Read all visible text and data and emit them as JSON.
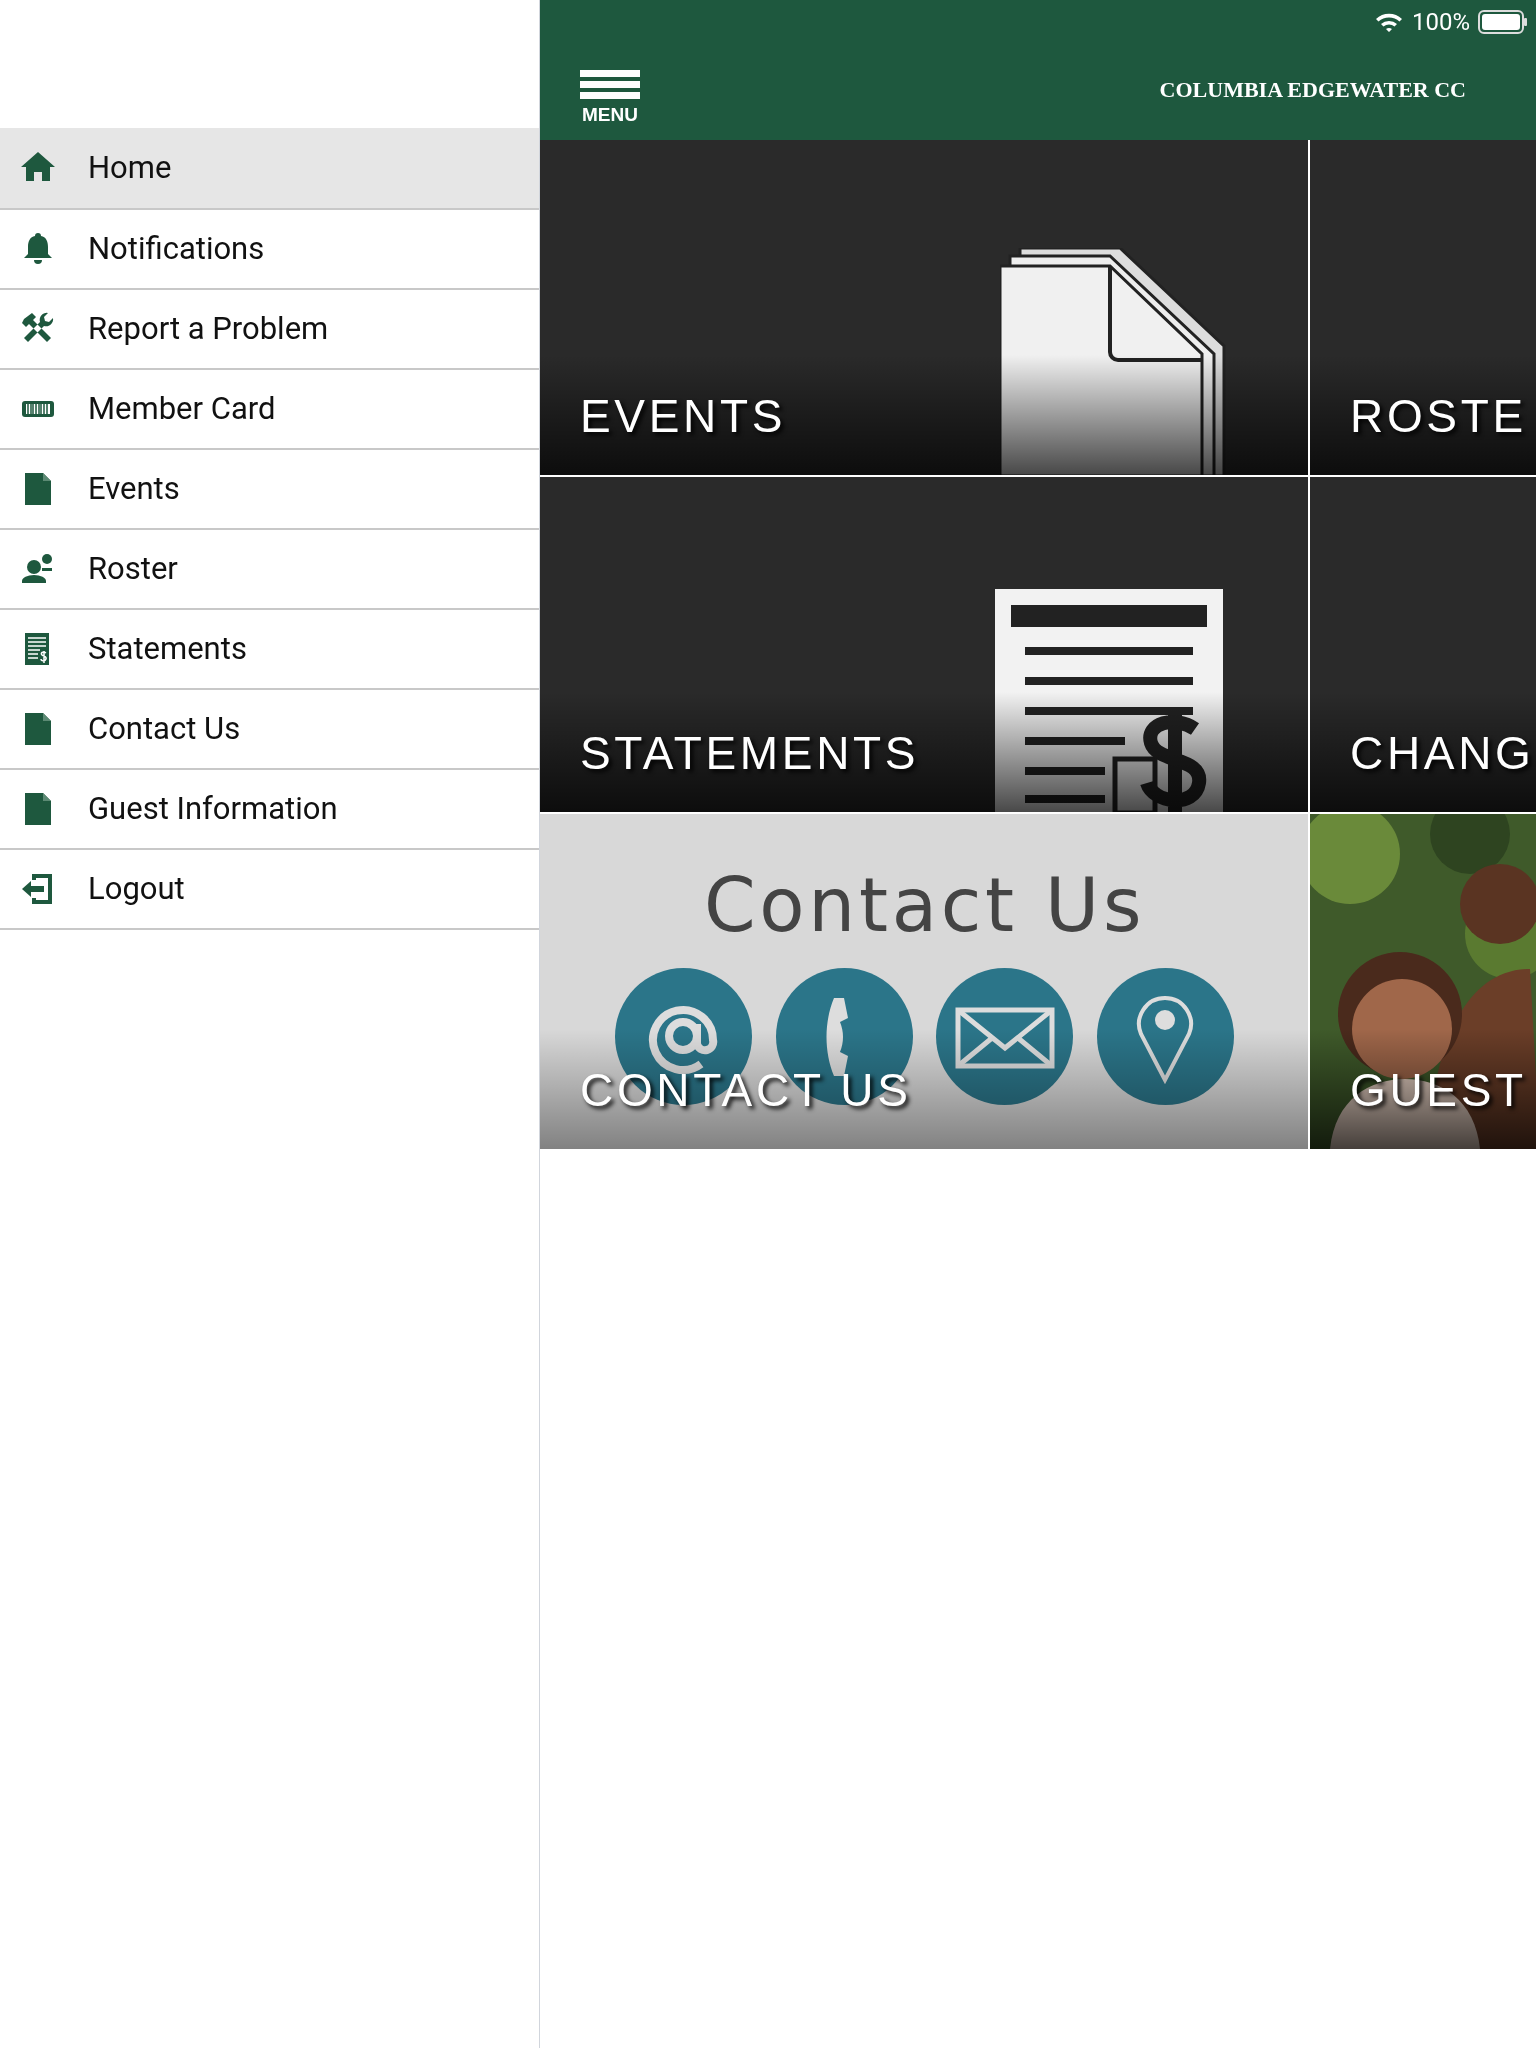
{
  "status_bar": {
    "battery": "100%"
  },
  "header": {
    "menu_label": "MENU",
    "title": "COLUMBIA EDGEWATER CC"
  },
  "sidebar": {
    "items": [
      {
        "label": "Home",
        "selected": true
      },
      {
        "label": "Notifications",
        "selected": false
      },
      {
        "label": "Report a Problem",
        "selected": false
      },
      {
        "label": "Member Card",
        "selected": false
      },
      {
        "label": "Events",
        "selected": false
      },
      {
        "label": "Roster",
        "selected": false
      },
      {
        "label": "Statements",
        "selected": false
      },
      {
        "label": "Contact Us",
        "selected": false
      },
      {
        "label": "Guest Information",
        "selected": false
      },
      {
        "label": "Logout",
        "selected": false
      }
    ]
  },
  "tiles": [
    {
      "label": "EVENTS",
      "kind": "events"
    },
    {
      "label": "ROSTE",
      "kind": "plain"
    },
    {
      "label": "STATEMENTS",
      "kind": "statements"
    },
    {
      "label": "CHANG",
      "kind": "plain"
    },
    {
      "label": "CONTACT US",
      "kind": "contact",
      "heading": "Contact Us"
    },
    {
      "label": "GUEST",
      "kind": "picture"
    }
  ]
}
